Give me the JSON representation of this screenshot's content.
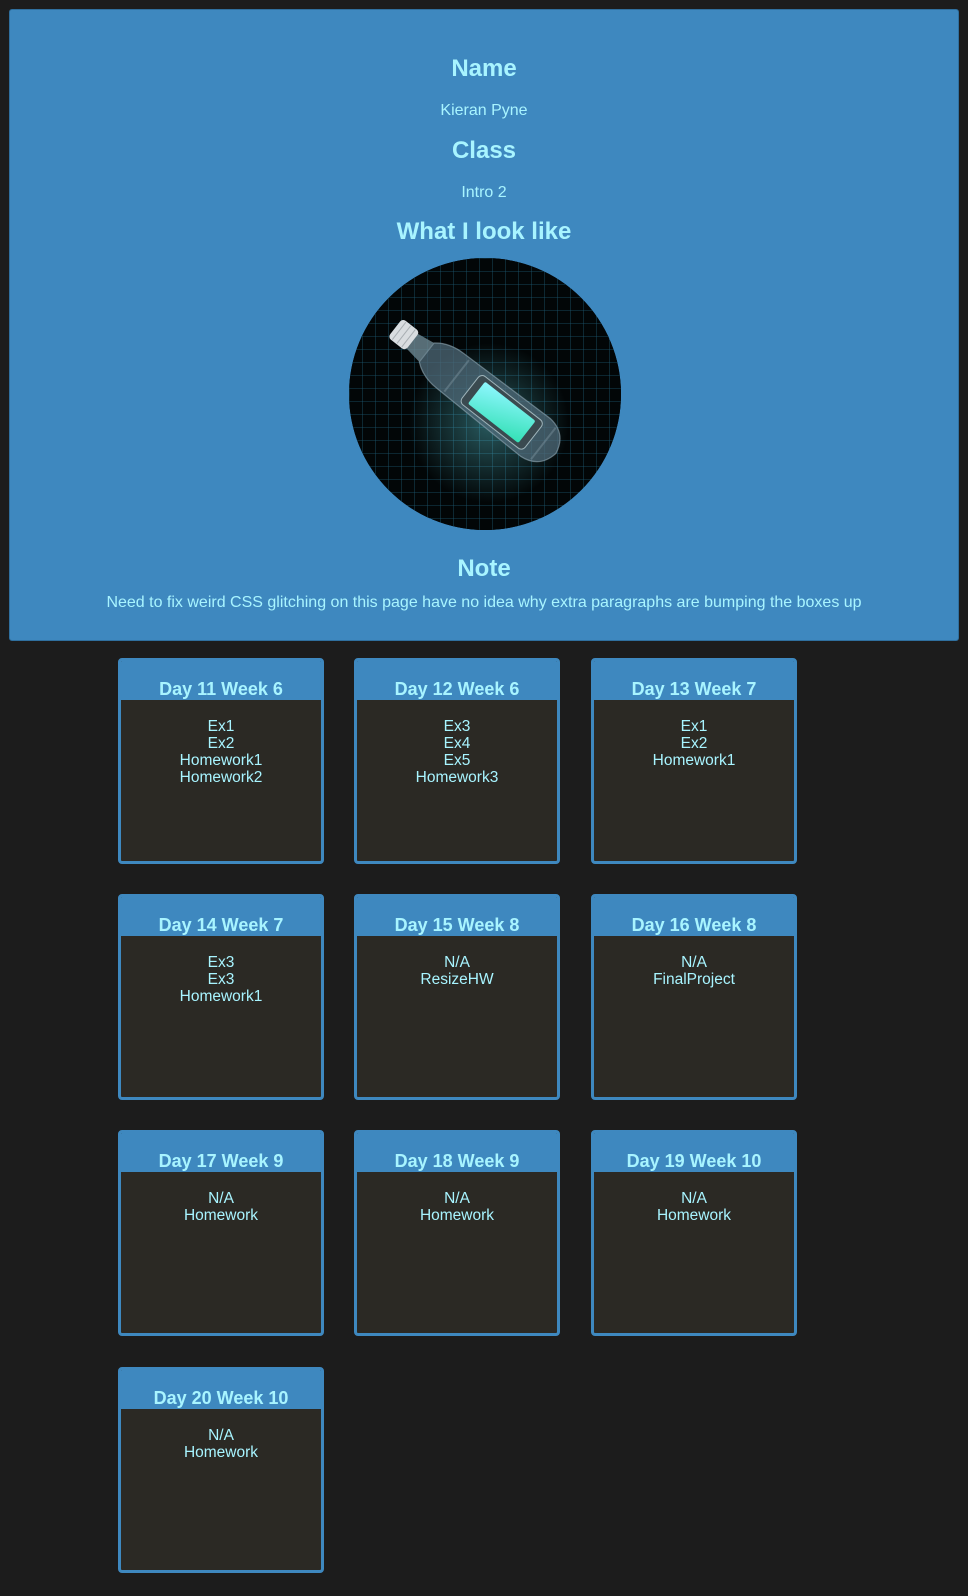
{
  "profile": {
    "name_heading": "Name",
    "name_value": "Kieran Pyne",
    "class_heading": "Class",
    "class_value": "Intro 2",
    "look_heading": "What I look like",
    "note_heading": "Note",
    "note_text": "Need to fix weird CSS glitching on this page have no idea why extra paragraphs are bumping the boxes up"
  },
  "days": [
    {
      "title": "Day 11 Week 6",
      "items": [
        "Ex1",
        "Ex2",
        "Homework1",
        "Homework2"
      ]
    },
    {
      "title": "Day 12 Week 6",
      "items": [
        "Ex3",
        "Ex4",
        "Ex5",
        "Homework3"
      ]
    },
    {
      "title": "Day 13 Week 7",
      "items": [
        "Ex1",
        "Ex2",
        "Homework1"
      ]
    },
    {
      "title": "Day 14 Week 7",
      "items": [
        "Ex3",
        "Ex3",
        "Homework1"
      ]
    },
    {
      "title": "Day 15 Week 8",
      "items": [
        "N/A",
        "ResizeHW"
      ]
    },
    {
      "title": "Day 16 Week 8",
      "items": [
        "N/A",
        "FinalProject"
      ]
    },
    {
      "title": "Day 17 Week 9",
      "items": [
        "N/A",
        "Homework"
      ]
    },
    {
      "title": "Day 18 Week 9",
      "items": [
        "N/A",
        "Homework"
      ]
    },
    {
      "title": "Day 19 Week 10",
      "items": [
        "N/A",
        "Homework"
      ]
    },
    {
      "title": "Day 20 Week 10",
      "items": [
        "N/A",
        "Homework"
      ]
    }
  ],
  "colors": {
    "page_background": "#1c1c1c",
    "panel_blue": "#3e88bf",
    "card_body": "#2b2924",
    "text_cyan": "#a8f4ff"
  }
}
